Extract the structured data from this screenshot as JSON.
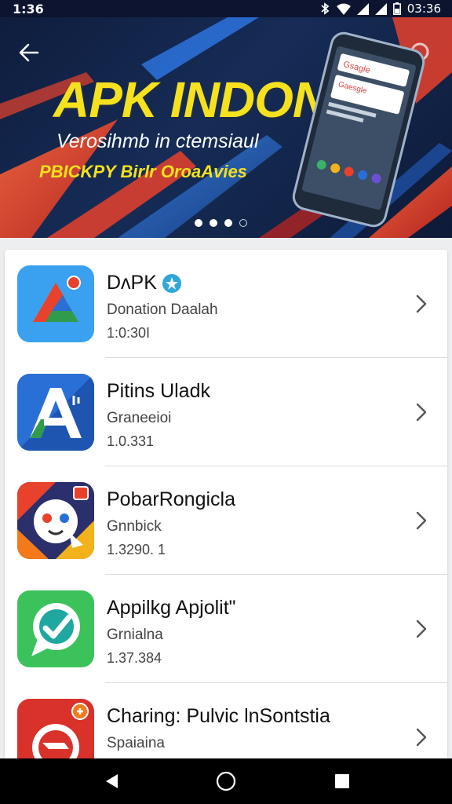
{
  "status_bar": {
    "time": "1:36",
    "clock": "03:36",
    "icons": [
      "bluetooth-icon",
      "wifi-icon",
      "signal-icon",
      "signal-icon",
      "battery-icon"
    ]
  },
  "banner": {
    "title": "APK INDONE",
    "subtitle": "Verosihmb in ctemsiaul",
    "tagline": "PBICKPY Birlr OroaAvies",
    "phone_screen_text_1": "Gsagle",
    "phone_screen_text_2": "Gaesgle",
    "page_indicator": {
      "count": 4,
      "active": 2
    },
    "colors": {
      "title": "#f5e11d",
      "accent_red": "#e8412c",
      "accent_blue": "#2a6fd6",
      "background": "#0f1d3d"
    }
  },
  "apps": [
    {
      "name": "DʌPK",
      "category": "Donation Daalah",
      "version": "1:0:30I",
      "icon": "drive-triangle-icon",
      "verified": true
    },
    {
      "name": "Pitins Uladk",
      "category": "Graneeioi",
      "version": "1.0.331",
      "icon": "letter-a-icon",
      "verified": false
    },
    {
      "name": "PobarRongicla",
      "category": "Gnnbick",
      "version": "1.3290. 1",
      "icon": "game-character-icon",
      "verified": false
    },
    {
      "name": "Appilkg Apjolit\"",
      "category": "Grnialna",
      "version": "1.37.384",
      "icon": "chat-bubble-icon",
      "verified": false
    },
    {
      "name": "Charing: Pulvic lnSontstia",
      "category": "Spaiaina",
      "version": "",
      "icon": "flag-red-icon",
      "verified": false
    }
  ],
  "nav_bar": {
    "buttons": [
      "back-triangle-icon",
      "home-circle-icon",
      "recents-square-icon"
    ]
  }
}
